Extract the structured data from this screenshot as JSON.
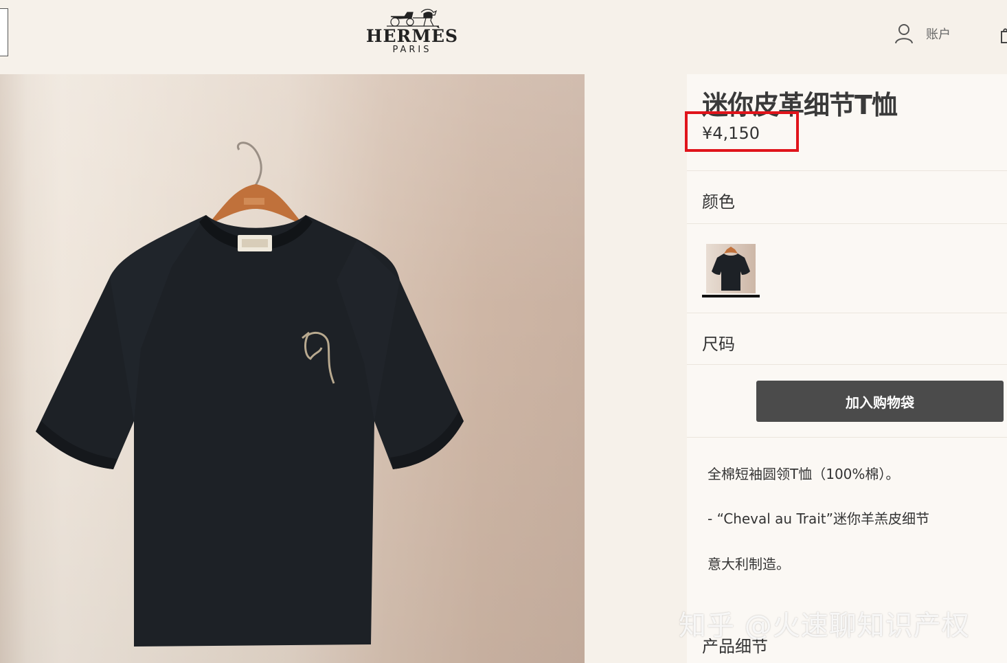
{
  "brand": {
    "name": "HERMÈS",
    "city": "PARIS"
  },
  "header": {
    "account_label": "账户"
  },
  "product": {
    "title": "迷你皮革细节T恤",
    "price": "¥4,150",
    "color_label": "颜色",
    "size_label": "尺码",
    "add_to_bag_label": "加入购物袋",
    "description": [
      "全棉短袖圆领T恤（100%棉）。",
      "-  “Cheval au Trait”迷你羊羔皮细节",
      "意大利制造。"
    ],
    "details_label": "产品细节"
  },
  "watermark": "知乎 @火速聊知识产权",
  "colors": {
    "highlight": "#e0141b",
    "button": "#4b4b4b"
  },
  "icons": [
    "search-icon",
    "carriage-logo-icon",
    "user-icon",
    "bag-icon"
  ]
}
